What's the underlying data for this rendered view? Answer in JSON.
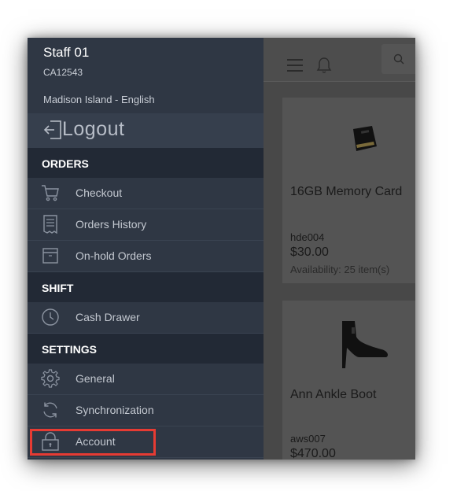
{
  "user": {
    "name": "Staff 01",
    "code": "CA12543",
    "store": "Madison Island - English"
  },
  "logout": {
    "label": "Logout",
    "icon": "logout-icon"
  },
  "sections": [
    {
      "title": "ORDERS",
      "items": [
        {
          "label": "Checkout",
          "icon": "cart-icon"
        },
        {
          "label": "Orders History",
          "icon": "receipt-icon"
        },
        {
          "label": "On-hold Orders",
          "icon": "box-icon"
        }
      ]
    },
    {
      "title": "SHIFT",
      "items": [
        {
          "label": "Cash Drawer",
          "icon": "clock-icon"
        }
      ]
    },
    {
      "title": "SETTINGS",
      "items": [
        {
          "label": "General",
          "icon": "gear-icon"
        },
        {
          "label": "Synchronization",
          "icon": "sync-icon"
        },
        {
          "label": "Account",
          "icon": "lock-icon"
        }
      ]
    }
  ],
  "topbar": {
    "menu_icon": "hamburger-icon",
    "notification_icon": "bell-icon",
    "search_icon": "search-icon"
  },
  "products": [
    {
      "name": "16GB Memory Card",
      "sku": "hde004",
      "price": "$30.00",
      "availability": "Availability: 25 item(s)",
      "image": "memory-card-image"
    },
    {
      "name": "Ann Ankle Boot",
      "sku": "aws007",
      "price": "$470.00",
      "image": "ankle-boot-image"
    }
  ],
  "colors": {
    "highlight": "#e63b33",
    "sidebar": "#2f3744",
    "section_header": "#222935"
  }
}
